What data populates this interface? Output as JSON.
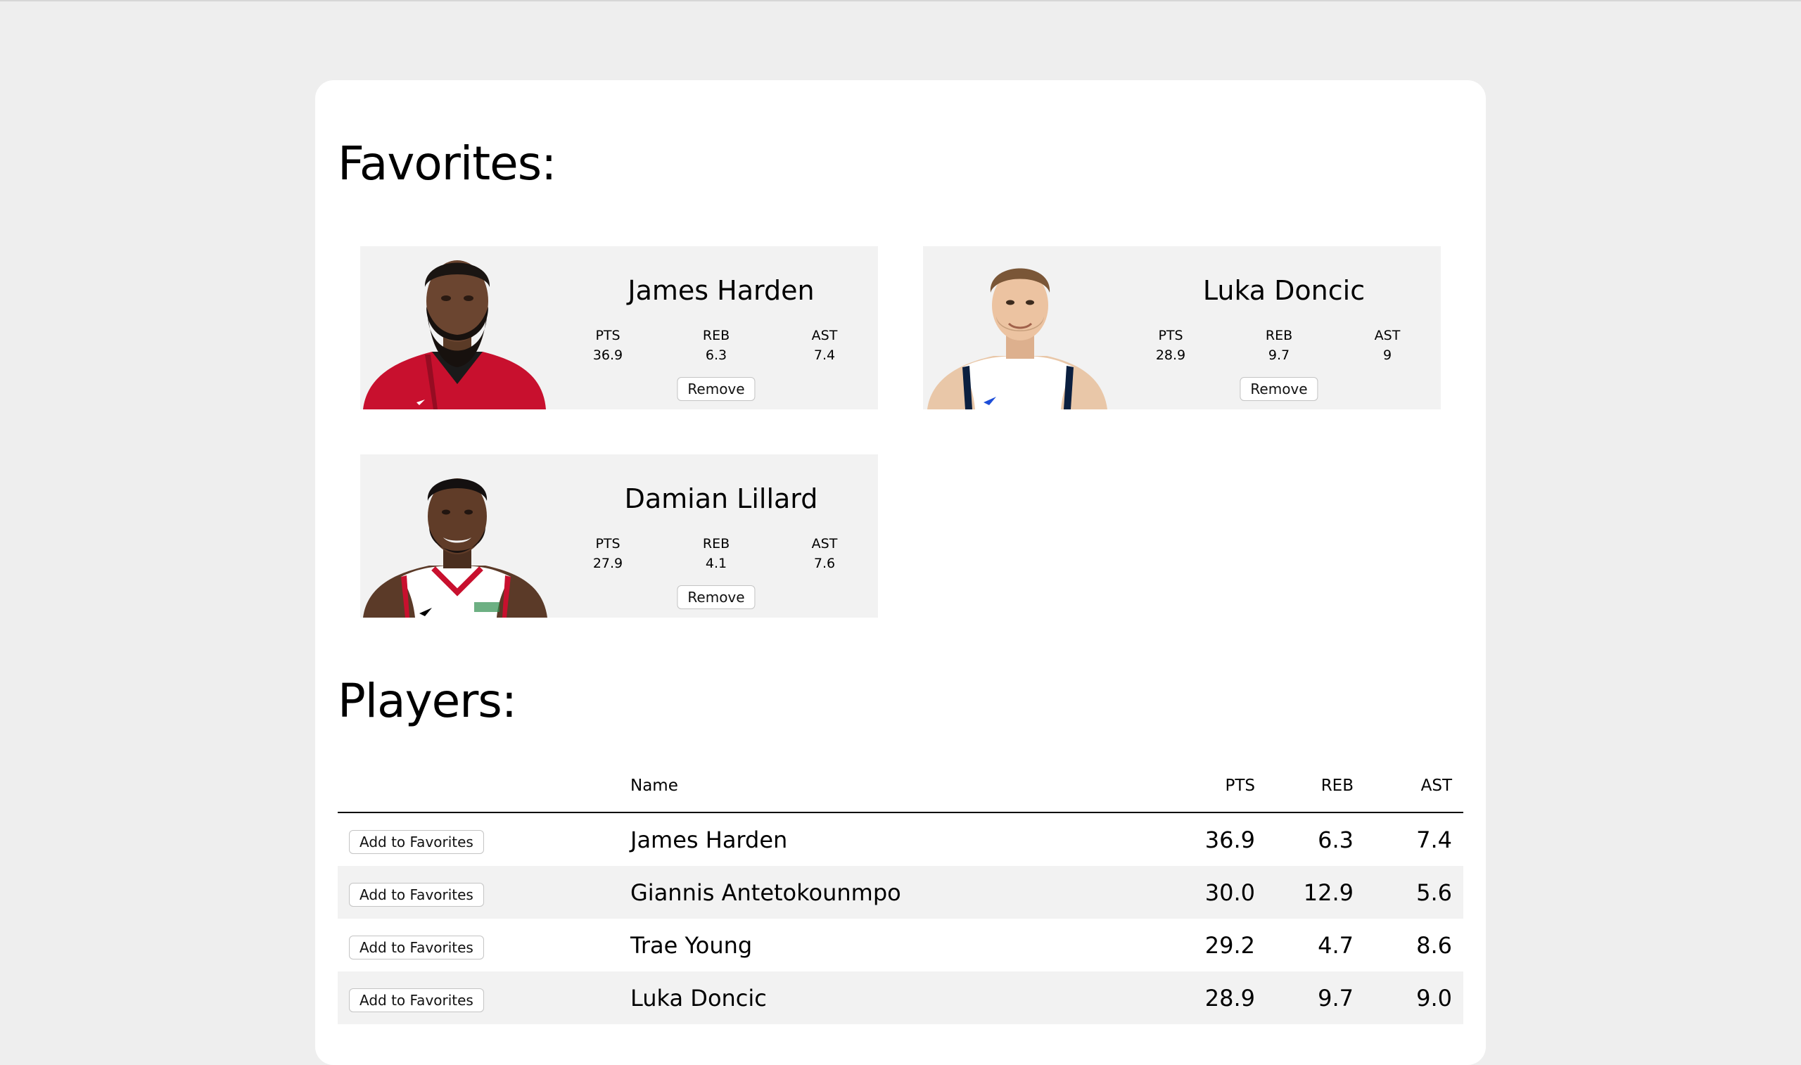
{
  "favorites": {
    "heading": "Favorites:",
    "cards": [
      {
        "name": "James Harden",
        "stats": [
          {
            "label": "PTS",
            "value": "36.9"
          },
          {
            "label": "REB",
            "value": "6.3"
          },
          {
            "label": "AST",
            "value": "7.4"
          }
        ],
        "remove_label": "Remove",
        "jersey_color": "#c8102e"
      },
      {
        "name": "Luka Doncic",
        "stats": [
          {
            "label": "PTS",
            "value": "28.9"
          },
          {
            "label": "REB",
            "value": "9.7"
          },
          {
            "label": "AST",
            "value": "9"
          }
        ],
        "remove_label": "Remove",
        "jersey_color": "#ffffff"
      },
      {
        "name": "Damian Lillard",
        "stats": [
          {
            "label": "PTS",
            "value": "27.9"
          },
          {
            "label": "REB",
            "value": "4.1"
          },
          {
            "label": "AST",
            "value": "7.6"
          }
        ],
        "remove_label": "Remove",
        "jersey_color": "#ffffff"
      }
    ]
  },
  "players": {
    "heading": "Players:",
    "columns": {
      "name": "Name",
      "pts": "PTS",
      "reb": "REB",
      "ast": "AST"
    },
    "add_label": "Add to Favorites",
    "rows": [
      {
        "name": "James Harden",
        "pts": "36.9",
        "reb": "6.3",
        "ast": "7.4"
      },
      {
        "name": "Giannis Antetokounmpo",
        "pts": "30.0",
        "reb": "12.9",
        "ast": "5.6"
      },
      {
        "name": "Trae Young",
        "pts": "29.2",
        "reb": "4.7",
        "ast": "8.6"
      },
      {
        "name": "Luka Doncic",
        "pts": "28.9",
        "reb": "9.7",
        "ast": "9.0"
      }
    ]
  }
}
